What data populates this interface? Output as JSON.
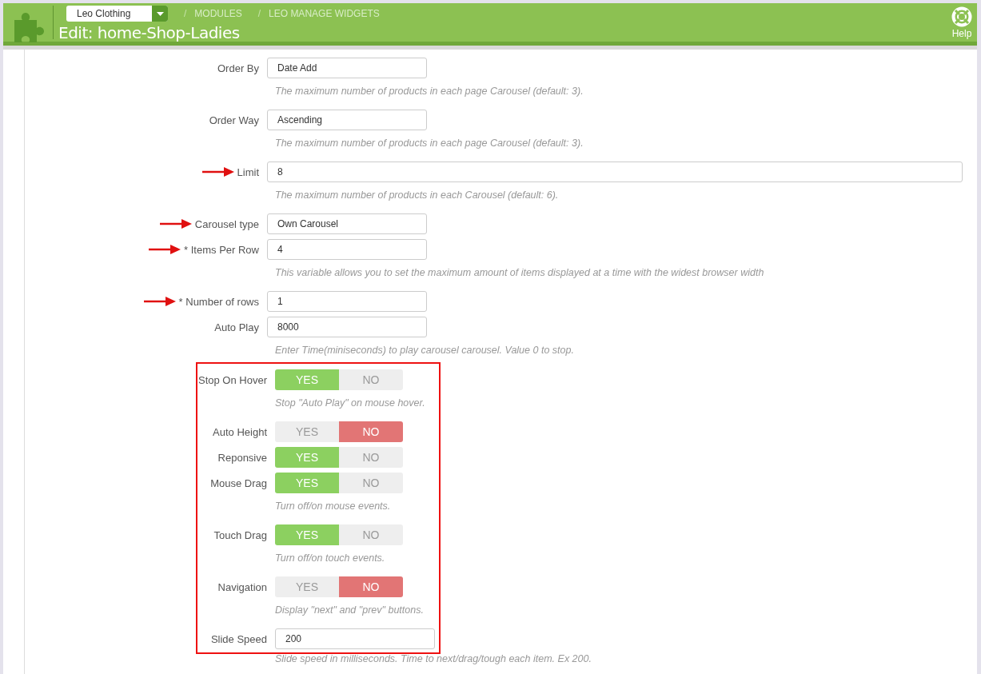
{
  "header": {
    "shop_selector": {
      "value": "Leo Clothing"
    },
    "breadcrumbs": [
      {
        "separator": "/",
        "label": "MODULES"
      },
      {
        "separator": "/",
        "label": "LEO MANAGE WIDGETS"
      }
    ],
    "title": "Edit: home-Shop-Ladies",
    "help": "Help"
  },
  "form": {
    "rows": [
      {
        "label": "Order By",
        "kind": "input",
        "value": "Date Add",
        "help": "The maximum number of products in each page Carousel (default: 3).",
        "arrow": false
      },
      {
        "label": "Order Way",
        "kind": "input",
        "value": "Ascending",
        "help": "The maximum number of products in each page Carousel (default: 3).",
        "arrow": false
      },
      {
        "label": "Limit",
        "kind": "input_wide",
        "value": "8",
        "help": "The maximum number of products in each Carousel (default: 6).",
        "arrow": true
      },
      {
        "label": "Carousel type",
        "kind": "input",
        "value": "Own Carousel",
        "arrow": true
      },
      {
        "label": "* Items Per Row",
        "kind": "input",
        "value": "4",
        "help": "This variable allows you to set the maximum amount of items displayed at a time with the widest browser width",
        "arrow": true
      },
      {
        "label": "* Number of rows",
        "kind": "input",
        "value": "1",
        "arrow": true
      },
      {
        "label": "Auto Play",
        "kind": "input",
        "value": "8000",
        "help": "Enter Time(miniseconds) to play carousel carousel. Value 0 to stop.",
        "arrow": false
      }
    ],
    "highlighted_rows": [
      {
        "label": "Stop On Hover",
        "kind": "toggle",
        "options": [
          "YES",
          "NO"
        ],
        "on": true,
        "help": "Stop \"Auto Play\" on mouse hover."
      },
      {
        "label": "Auto Height",
        "kind": "toggle",
        "options": [
          "YES",
          "NO"
        ],
        "on": false
      },
      {
        "label": "Reponsive",
        "kind": "toggle",
        "options": [
          "YES",
          "NO"
        ],
        "on": true
      },
      {
        "label": "Mouse Drag",
        "kind": "toggle",
        "options": [
          "YES",
          "NO"
        ],
        "on": true,
        "help": "Turn off/on mouse events."
      },
      {
        "label": "Touch Drag",
        "kind": "toggle",
        "options": [
          "YES",
          "NO"
        ],
        "on": true,
        "help": "Turn off/on touch events."
      },
      {
        "label": "Navigation",
        "kind": "toggle",
        "options": [
          "YES",
          "NO"
        ],
        "on": false,
        "help": "Display \"next\" and \"prev\" buttons."
      },
      {
        "label": "Slide Speed",
        "kind": "input",
        "value": "200",
        "help": "Slide speed in milliseconds. Time to next/drag/tough each item. Ex 200."
      }
    ]
  }
}
